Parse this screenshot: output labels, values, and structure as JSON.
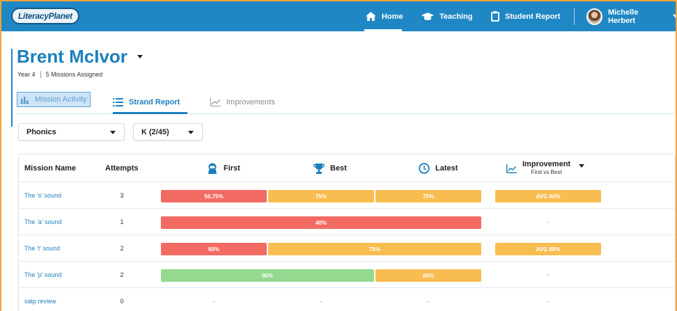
{
  "app": {
    "logo_text": "LiteracyPlanet"
  },
  "nav": {
    "home": "Home",
    "teaching": "Teaching",
    "student_report": "Student Report",
    "user_name": "Michelle Herbert"
  },
  "student": {
    "name": "Brent McIvor",
    "year": "Year 4",
    "missions": "5 Missions Assigned"
  },
  "tabs": {
    "mission_activity": "Mission Activity",
    "strand_report": "Strand Report",
    "improvements": "Improvements"
  },
  "filters": {
    "strand": "Phonics",
    "level": "K (2/45)"
  },
  "table": {
    "headers": {
      "mission_name": "Mission Name",
      "attempts": "Attempts",
      "first": "First",
      "best": "Best",
      "latest": "Latest",
      "improvement": "Improvement",
      "improvement_sub": "First vs Best"
    },
    "rows": [
      {
        "name": "The 's' sound",
        "attempts": "3",
        "first": "56.75%",
        "best": "75%",
        "latest": "75%",
        "improvement": "AVG 60%"
      },
      {
        "name": "The 'a' sound",
        "attempts": "1",
        "merged": "40%",
        "improvement": "-"
      },
      {
        "name": "The 't' sound",
        "attempts": "2",
        "first": "60%",
        "best_latest": "75%",
        "improvement": "AVG 68%"
      },
      {
        "name": "The 'p' sound",
        "attempts": "2",
        "first_best": "90%",
        "latest": "80%",
        "improvement": "-"
      },
      {
        "name": "satp review",
        "attempts": "0",
        "first": "-",
        "best": "-",
        "latest": "-",
        "improvement": "-"
      }
    ]
  },
  "colors": {
    "nav_blue": "#1f87c4",
    "score_low": "#f26b62",
    "score_mid": "#f8bd50",
    "score_high": "#95d88f"
  }
}
